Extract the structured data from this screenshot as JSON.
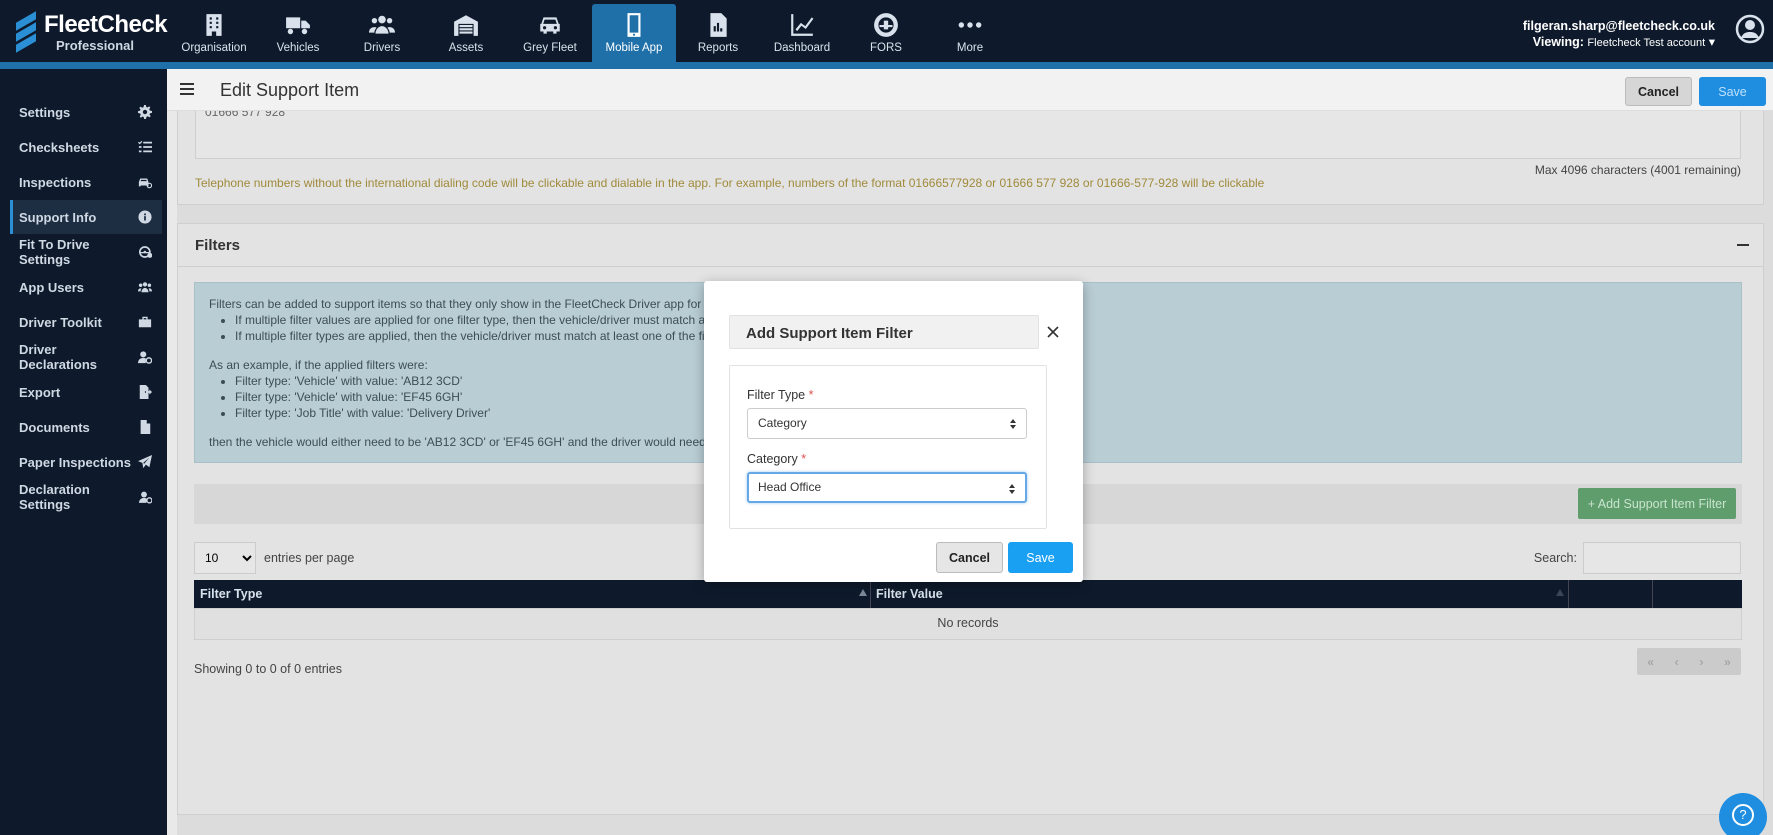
{
  "brand": {
    "name": "FleetCheck",
    "edition": "Professional"
  },
  "nav": [
    {
      "label": "Organisation",
      "icon": "building-icon"
    },
    {
      "label": "Vehicles",
      "icon": "truck-icon"
    },
    {
      "label": "Drivers",
      "icon": "users-icon"
    },
    {
      "label": "Assets",
      "icon": "warehouse-icon"
    },
    {
      "label": "Grey Fleet",
      "icon": "car-icon"
    },
    {
      "label": "Mobile App",
      "icon": "mobile-icon",
      "active": true
    },
    {
      "label": "Reports",
      "icon": "report-icon"
    },
    {
      "label": "Dashboard",
      "icon": "chart-line-icon"
    },
    {
      "label": "FORS",
      "icon": "fors-icon"
    },
    {
      "label": "More",
      "icon": "ellipsis-icon"
    }
  ],
  "user": {
    "email": "filgeran.sharp@fleetcheck.co.uk",
    "viewing_label": "Viewing:",
    "viewing_value": "Fleetcheck Test account"
  },
  "sidebar": [
    {
      "label": "Settings",
      "icon": "gear-icon"
    },
    {
      "label": "Checksheets",
      "icon": "list-check-icon"
    },
    {
      "label": "Inspections",
      "icon": "car-search-icon"
    },
    {
      "label": "Support Info",
      "icon": "info-icon",
      "active": true
    },
    {
      "label": "Fit To Drive Settings",
      "icon": "steering-icon"
    },
    {
      "label": "App Users",
      "icon": "users-icon"
    },
    {
      "label": "Driver Toolkit",
      "icon": "toolbox-icon"
    },
    {
      "label": "Driver Declarations",
      "icon": "user-gear-icon"
    },
    {
      "label": "Export",
      "icon": "file-export-icon"
    },
    {
      "label": "Documents",
      "icon": "file-icon"
    },
    {
      "label": "Paper Inspections",
      "icon": "paper-plane-icon"
    },
    {
      "label": "Declaration Settings",
      "icon": "user-gear-icon"
    }
  ],
  "header": {
    "title": "Edit Support Item",
    "cancel": "Cancel",
    "save": "Save"
  },
  "phone_section": {
    "value": "01666 577 928",
    "max_chars": "Max 4096 characters (4001 remaining)",
    "note": "Telephone numbers without the international dialing code will be clickable and dialable in the app. For example, numbers of the format 01666577928 or 01666 577 928 or 01666-577-928 will be clickable"
  },
  "filters": {
    "title": "Filters",
    "info_intro": "Filters can be added to support items so that they only show in the FleetCheck Driver app for th",
    "info_rule1": "If multiple filter values are applied for one filter type, then the vehicle/driver must match a",
    "info_rule2": "If multiple filter types are applied, then the vehicle/driver must match at least one of the fil",
    "example_intro": "As an example, if the applied filters were:",
    "example1": "Filter type: 'Vehicle' with value: 'AB12 3CD'",
    "example2": "Filter type: 'Vehicle' with value: 'EF45 6GH'",
    "example3": "Filter type: 'Job Title' with value: 'Delivery Driver'",
    "example_outro": "then the vehicle would either need to be 'AB12 3CD' or 'EF45 6GH' and the driver would need to",
    "add_button": "+ Add Support Item Filter",
    "entries_value": "10",
    "entries_label": "entries per page",
    "search_label": "Search:",
    "columns": [
      "Filter Type",
      "Filter Value"
    ],
    "empty": "No records",
    "showing": "Showing 0 to 0 of 0 entries",
    "pager": [
      "«",
      "‹",
      "›",
      "»"
    ]
  },
  "modal": {
    "title": "Add Support Item Filter",
    "filter_type_label": "Filter Type",
    "filter_type_value": "Category",
    "category_label": "Category",
    "category_value": "Head Office",
    "required_mark": "*",
    "cancel": "Cancel",
    "save": "Save"
  },
  "help": "?",
  "colors": {
    "nav_bg": "#0e1a2b",
    "accent": "#1f6fa8",
    "primary_button": "#1aa0f2",
    "success_button": "#5f9d6d"
  }
}
